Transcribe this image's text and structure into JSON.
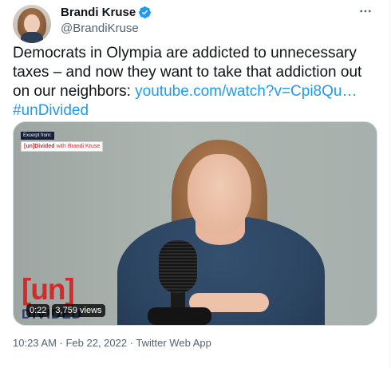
{
  "author": {
    "name": "Brandi Kruse",
    "handle": "@BrandiKruse",
    "verified": true,
    "avatar": "avatar-photo"
  },
  "more_icon": "more-horizontal-icon",
  "tweet": {
    "text_before_link": "Democrats in Olympia are addicted to unnecessary taxes – and now they want to take that addiction out on our neighbors: ",
    "link": "youtube.com/watch?v=Cpi8Qu…",
    "hashtag": "#unDivided"
  },
  "media": {
    "type": "video",
    "excerpt_label": "Excerpt from:",
    "show_label_prefix": "[un]Divided",
    "show_label_suffix": " with Brandi Kruse",
    "logo_un": "[un]",
    "logo_divided": "DIVIDED",
    "duration": "0:22",
    "views": "3,759 views"
  },
  "meta": {
    "timestamp": "10:23 AM · Feb 22, 2022 · Twitter Web App"
  },
  "colors": {
    "link": "#1d9bf0",
    "text": "#0f1419",
    "secondary": "#536471",
    "verified": "#1d9bf0"
  }
}
